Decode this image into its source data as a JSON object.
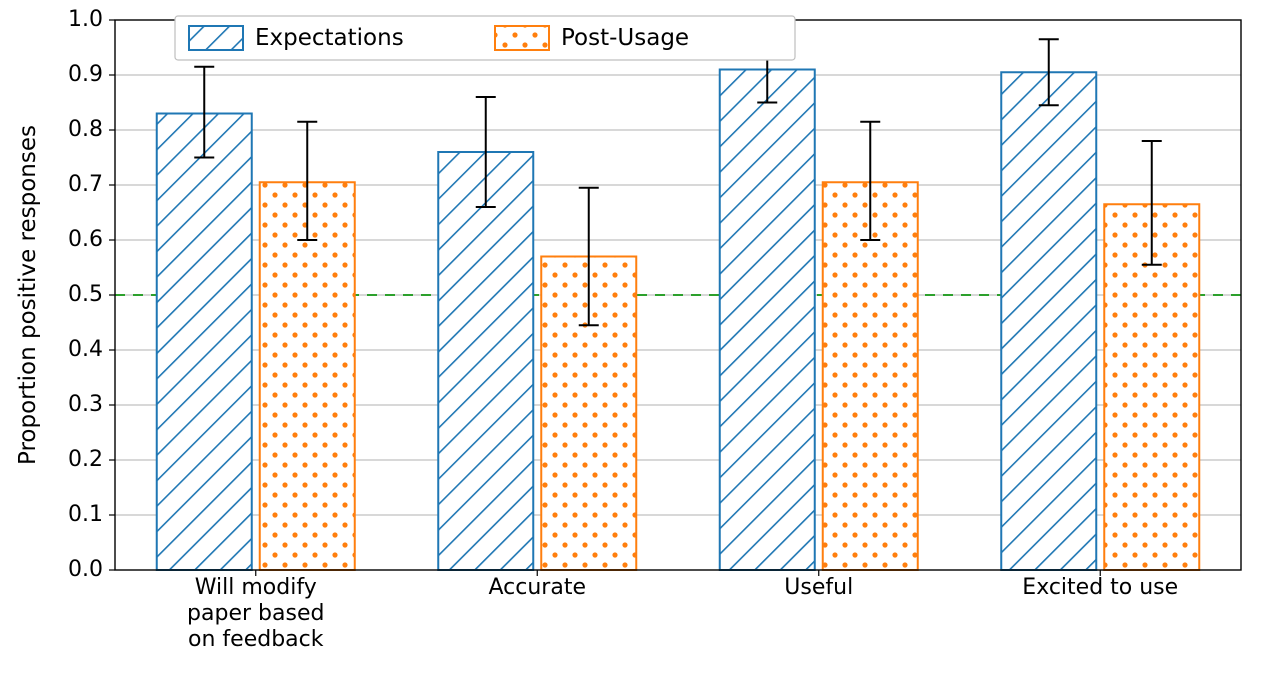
{
  "chart_data": {
    "type": "bar",
    "ylabel": "Proportion positive responses",
    "ylim": [
      0.0,
      1.0
    ],
    "yticks": [
      0.0,
      0.1,
      0.2,
      0.3,
      0.4,
      0.5,
      0.6,
      0.7,
      0.8,
      0.9,
      1.0
    ],
    "ytick_labels": [
      "0.0",
      "0.1",
      "0.2",
      "0.3",
      "0.4",
      "0.5",
      "0.6",
      "0.7",
      "0.8",
      "0.9",
      "1.0"
    ],
    "reference_line": 0.5,
    "categories": [
      "Will modify paper based on feedback",
      "Accurate",
      "Useful",
      "Excited to use"
    ],
    "category_labels_multiline": [
      [
        "Will modify",
        "paper based",
        "on feedback"
      ],
      [
        "Accurate"
      ],
      [
        "Useful"
      ],
      [
        "Excited to use"
      ]
    ],
    "series": [
      {
        "name": "Expectations",
        "legend_label": "Expectations",
        "color": "#1f77b4",
        "pattern": "diagonal",
        "values": [
          0.83,
          0.76,
          0.91,
          0.905
        ],
        "err_low": [
          0.75,
          0.66,
          0.85,
          0.845
        ],
        "err_high": [
          0.915,
          0.86,
          0.965,
          0.965
        ]
      },
      {
        "name": "Post-Usage",
        "legend_label": "Post-Usage",
        "color": "#ff7f0e",
        "pattern": "dots",
        "values": [
          0.705,
          0.57,
          0.705,
          0.665
        ],
        "err_low": [
          0.6,
          0.445,
          0.6,
          0.555
        ],
        "err_high": [
          0.815,
          0.695,
          0.815,
          0.78
        ]
      }
    ]
  },
  "legend": {
    "items": [
      "Expectations",
      "Post-Usage"
    ]
  },
  "colors": {
    "axis": "#000000",
    "grid": "#b0b0b0",
    "ref_line": "#2ca02c",
    "series1": "#1f77b4",
    "series1_fill": "#ffffff",
    "series2": "#ff7f0e",
    "series2_fill": "#ffffff",
    "error": "#000000"
  }
}
